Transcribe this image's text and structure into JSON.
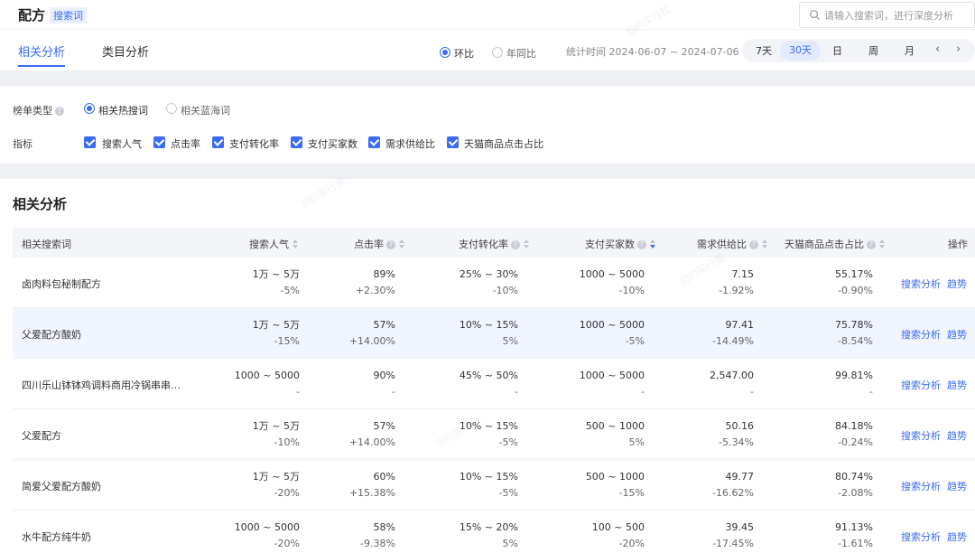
{
  "header": {
    "title": "配方",
    "tag": "搜索词",
    "search_placeholder": "请输入搜索词，进行深度分析"
  },
  "tabs": [
    {
      "label": "相关分析",
      "active": true
    },
    {
      "label": "类目分析",
      "active": false
    }
  ],
  "compare": {
    "options": [
      {
        "label": "环比",
        "selected": true
      },
      {
        "label": "年同比",
        "selected": false
      }
    ]
  },
  "date_range": "统计时间 2024-06-07 ~ 2024-07-06",
  "periods": [
    {
      "label": "7天",
      "active": false
    },
    {
      "label": "30天",
      "active": true
    },
    {
      "label": "日",
      "active": false
    },
    {
      "label": "周",
      "active": false
    },
    {
      "label": "月",
      "active": false
    }
  ],
  "filters": {
    "rank_type_label": "榜单类型",
    "rank_types": [
      {
        "label": "相关热搜词",
        "selected": true
      },
      {
        "label": "相关蓝海词",
        "selected": false
      }
    ],
    "metric_label": "指标",
    "metrics": [
      {
        "label": "搜索人气",
        "checked": true
      },
      {
        "label": "点击率",
        "checked": true
      },
      {
        "label": "支付转化率",
        "checked": true
      },
      {
        "label": "支付买家数",
        "checked": true
      },
      {
        "label": "需求供给比",
        "checked": true
      },
      {
        "label": "天猫商品点击占比",
        "checked": true
      }
    ]
  },
  "table": {
    "title": "相关分析",
    "columns": [
      "相关搜索词",
      "搜索人气",
      "点击率",
      "支付转化率",
      "支付买家数",
      "需求供给比",
      "天猫商品点击占比",
      "操作"
    ],
    "action_labels": [
      "搜索分析",
      "趋势"
    ],
    "rows": [
      {
        "keyword": "卤肉料包秘制配方",
        "cells": [
          [
            "1万 ~ 5万",
            "-5%"
          ],
          [
            "89%",
            "+2.30%"
          ],
          [
            "25% ~ 30%",
            "-10%"
          ],
          [
            "1000 ~ 5000",
            "-10%"
          ],
          [
            "7.15",
            "-1.92%"
          ],
          [
            "55.17%",
            "-0.90%"
          ]
        ]
      },
      {
        "keyword": "父爱配方酸奶",
        "cells": [
          [
            "1万 ~ 5万",
            "-15%"
          ],
          [
            "57%",
            "+14.00%"
          ],
          [
            "10% ~ 15%",
            "5%"
          ],
          [
            "1000 ~ 5000",
            "-5%"
          ],
          [
            "97.41",
            "-14.49%"
          ],
          [
            "75.78%",
            "-8.54%"
          ]
        ]
      },
      {
        "keyword": "四川乐山钵钵鸡调料商用冷锅串串…",
        "cells": [
          [
            "1000 ~ 5000",
            "-"
          ],
          [
            "90%",
            "-"
          ],
          [
            "45% ~ 50%",
            "-"
          ],
          [
            "1000 ~ 5000",
            "-"
          ],
          [
            "2,547.00",
            "-"
          ],
          [
            "99.81%",
            "-"
          ]
        ]
      },
      {
        "keyword": "父爱配方",
        "cells": [
          [
            "1万 ~ 5万",
            "-10%"
          ],
          [
            "57%",
            "+14.00%"
          ],
          [
            "10% ~ 15%",
            "-5%"
          ],
          [
            "500 ~ 1000",
            "5%"
          ],
          [
            "50.16",
            "-5.34%"
          ],
          [
            "84.18%",
            "-0.24%"
          ]
        ]
      },
      {
        "keyword": "简爱父爱配方酸奶",
        "cells": [
          [
            "1万 ~ 5万",
            "-20%"
          ],
          [
            "60%",
            "+15.38%"
          ],
          [
            "10% ~ 15%",
            "-5%"
          ],
          [
            "500 ~ 1000",
            "-15%"
          ],
          [
            "49.77",
            "-16.62%"
          ],
          [
            "80.74%",
            "-2.08%"
          ]
        ]
      },
      {
        "keyword": "水牛配方纯牛奶",
        "cells": [
          [
            "1000 ~ 5000",
            "-20%"
          ],
          [
            "58%",
            "-9.38%"
          ],
          [
            "15% ~ 20%",
            "5%"
          ],
          [
            "100 ~ 500",
            "-20%"
          ],
          [
            "39.45",
            "-17.45%"
          ],
          [
            "91.13%",
            "-1.61%"
          ]
        ]
      }
    ]
  },
  "watermark_text": "旧约买行我"
}
